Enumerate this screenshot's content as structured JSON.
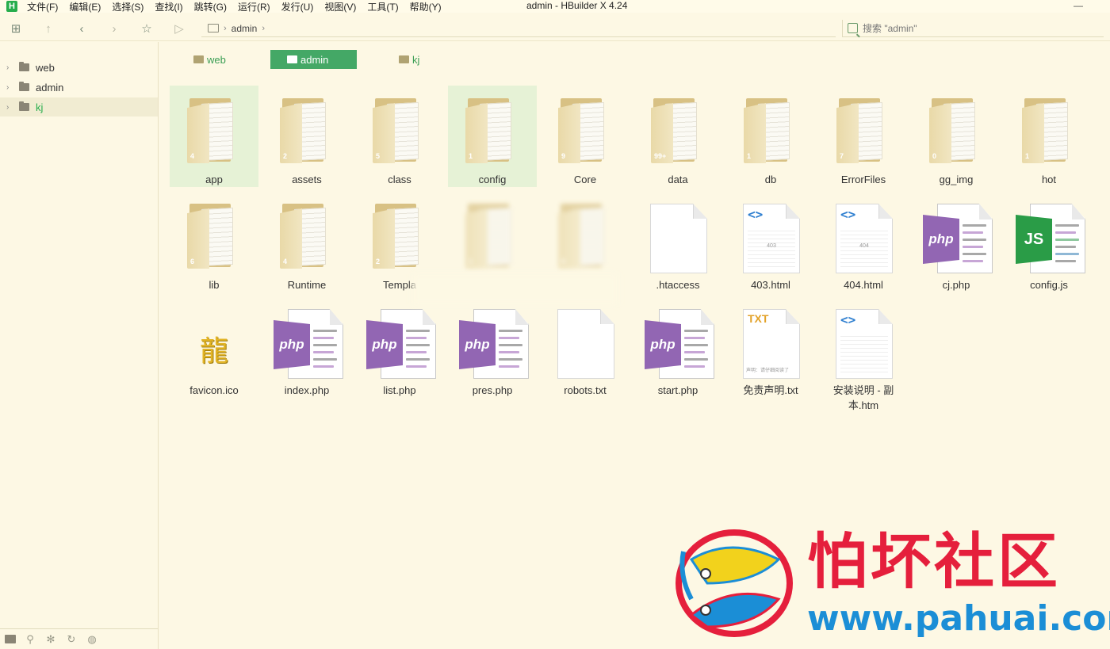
{
  "window": {
    "title": "admin - HBuilder X 4.24",
    "logo_letter": "H"
  },
  "menu": [
    "文件(F)",
    "编辑(E)",
    "选择(S)",
    "查找(I)",
    "跳转(G)",
    "运行(R)",
    "发行(U)",
    "视图(V)",
    "工具(T)",
    "帮助(Y)"
  ],
  "toolbar": {
    "path_segment": "admin",
    "search_placeholder": "搜索 \"admin\""
  },
  "sidebar": {
    "items": [
      {
        "label": "web",
        "selected": false
      },
      {
        "label": "admin",
        "selected": false
      },
      {
        "label": "kj",
        "selected": true
      }
    ]
  },
  "tabs": [
    {
      "label": "web",
      "active": false
    },
    {
      "label": "admin",
      "active": true
    },
    {
      "label": "kj",
      "active": false
    }
  ],
  "files": [
    {
      "name": "app",
      "type": "folder",
      "count": "4",
      "selected": true
    },
    {
      "name": "assets",
      "type": "folder",
      "count": "2"
    },
    {
      "name": "class",
      "type": "folder",
      "count": "5"
    },
    {
      "name": "config",
      "type": "folder",
      "count": "1",
      "selected": true
    },
    {
      "name": "Core",
      "type": "folder",
      "count": "9"
    },
    {
      "name": "data",
      "type": "folder",
      "count": "99+"
    },
    {
      "name": "db",
      "type": "folder",
      "count": "1"
    },
    {
      "name": "ErrorFiles",
      "type": "folder",
      "count": "7"
    },
    {
      "name": "gg_img",
      "type": "folder",
      "count": "0"
    },
    {
      "name": "hot",
      "type": "folder",
      "count": "1"
    },
    {
      "name": "lib",
      "type": "folder",
      "count": "6"
    },
    {
      "name": "Runtime",
      "type": "folder",
      "count": "4"
    },
    {
      "name": "Templa",
      "type": "folder",
      "count": "2"
    },
    {
      "name": "",
      "type": "folder",
      "count": "1",
      "blurred": true
    },
    {
      "name": "",
      "type": "folder",
      "count": "0",
      "blurred": true
    },
    {
      "name": ".htaccess",
      "type": "blank"
    },
    {
      "name": "403.html",
      "type": "html",
      "sub": "403"
    },
    {
      "name": "404.html",
      "type": "html",
      "sub": "404"
    },
    {
      "name": "cj.php",
      "type": "php",
      "badge": "php"
    },
    {
      "name": "config.js",
      "type": "js",
      "badge": "JS"
    },
    {
      "name": "favicon.ico",
      "type": "favicon",
      "glyph": "龍"
    },
    {
      "name": "index.php",
      "type": "php",
      "badge": "php"
    },
    {
      "name": "list.php",
      "type": "php",
      "badge": "php"
    },
    {
      "name": "pres.php",
      "type": "php",
      "badge": "php"
    },
    {
      "name": "robots.txt",
      "type": "blank"
    },
    {
      "name": "start.php",
      "type": "php",
      "badge": "php"
    },
    {
      "name": "免责声明.txt",
      "type": "txt",
      "badge": "TXT",
      "foot": "声明：请仔细阅读了"
    },
    {
      "name": "安装说明 - 副本.htm",
      "type": "html",
      "sub": ""
    }
  ],
  "colors": {
    "background": "#fdf8e4",
    "accent": "#44a866",
    "php": "#9266b3",
    "js": "#2a9c47",
    "watermark_red": "#e51f3c",
    "watermark_blue": "#1b8ed6"
  },
  "watermark": {
    "title": "怕坏社区",
    "url": "www.pahuai.com"
  }
}
